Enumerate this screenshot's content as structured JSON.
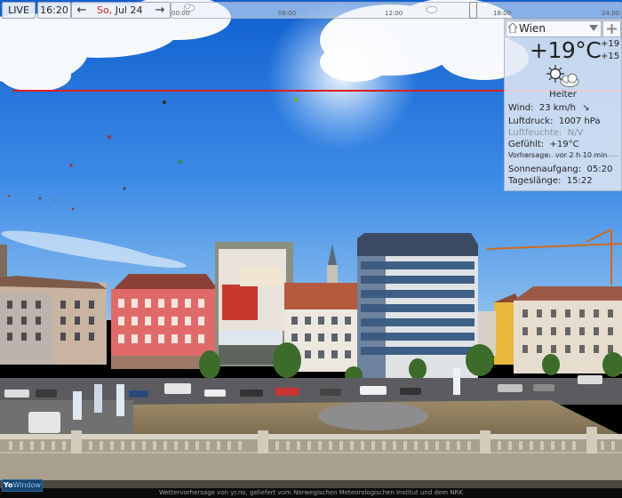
{
  "toolbar": {
    "live_label": "LIVE",
    "time": "16:20",
    "date_dow": "So,",
    "date_rest": " Jul 24",
    "prev_icon": "arrow-left-icon",
    "next_icon": "arrow-right-icon",
    "timeline": {
      "labels": [
        "00:00",
        "06:00",
        "12:00",
        "18:00",
        "24:00"
      ],
      "handle_time": "16:20",
      "icons": [
        "cloud-icon",
        "cloud-sun-icon"
      ]
    }
  },
  "weather": {
    "city": "Wien",
    "temperature": "+19°C",
    "temp_max": "+19",
    "temp_min": "+15",
    "condition": "Heiter",
    "condition_icon": "sun-cloud-icon",
    "wind_label": "Wind:",
    "wind_value": "23 km/h",
    "wind_icon": "arrow-down-right-icon",
    "pressure_label": "Luftdruck:",
    "pressure_value": "1007 hPa",
    "humidity_label": "Luftfeuchte:",
    "humidity_value": "N/V",
    "feels_label": "Gefühlt:",
    "feels_value": "+19°C",
    "forecast_label": "Vorhersage:",
    "forecast_value": "vor 2 h 10 min",
    "sunrise_label": "Sonnenaufgang:",
    "sunrise_value": "05:20",
    "daylength_label": "Tageslänge:",
    "daylength_value": "15:22"
  },
  "footer": {
    "logo_a": "Yo",
    "logo_b": "Window",
    "credit": "Wettervorhersage von yr.no, geliefert vom Norwegischen Meteorologischen Institut und dem NRK"
  },
  "colors": {
    "horizon_line": "#e01d1d",
    "sky_top": "#1a6fd6",
    "sky_bottom": "#7fb3ea"
  }
}
